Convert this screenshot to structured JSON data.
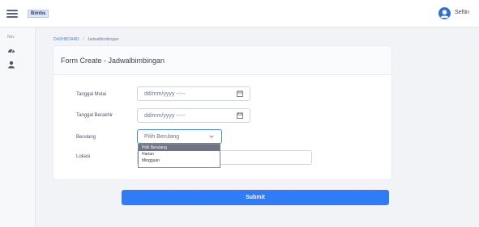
{
  "topbar": {
    "brand": "Bimbs",
    "user_name": "Seftin"
  },
  "sidebar": {
    "section_label": "Nav"
  },
  "breadcrumb": {
    "home": "DASHBOARD",
    "separator": "/",
    "current": "Jadwalbimbingan"
  },
  "form": {
    "title": "Form Create - Jadwalbimbingan",
    "tanggal_mulai": {
      "label": "Tanggal Mulai",
      "placeholder": "dd/mm/yyyy --:--"
    },
    "tanggal_berakhir": {
      "label": "Tanggal Berakhir",
      "placeholder": "dd/mm/yyyy --:--"
    },
    "berulang": {
      "label": "Berulang",
      "selected": "Pilih Berulang",
      "options": [
        "Pilih Berulang",
        "Harian",
        "Mingguan"
      ]
    },
    "lokasi": {
      "label": "Lokasi",
      "value": ""
    },
    "submit_label": "Submit"
  },
  "colors": {
    "primary": "#2f7df6",
    "page_bg": "#f1f3f7",
    "dropdown_highlight": "#6f7482"
  }
}
